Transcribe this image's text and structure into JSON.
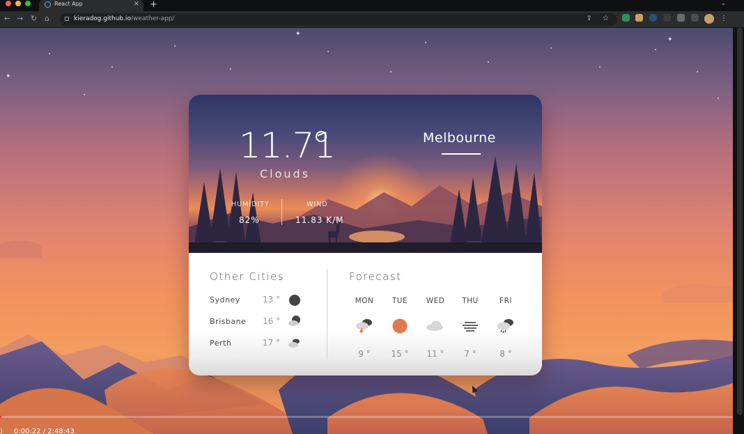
{
  "browser": {
    "tab_title": "React App",
    "tab_close": "×",
    "new_tab": "+",
    "tab_menu": "⌄",
    "url_host": "kieradog.github.io",
    "url_path": "/weather-app/",
    "back": "←",
    "forward": "→",
    "reload": "↻",
    "home": "⌂",
    "omnibox_icons": "⇪ ☆",
    "menu": "⋮"
  },
  "weather": {
    "temperature": "11.71",
    "condition": "Clouds",
    "city": "Melbourne",
    "humidity_label": "HUMIDITY",
    "humidity_value": "82%",
    "wind_label": "WIND",
    "wind_value": "11.83 K/M"
  },
  "other_cities": {
    "title": "Other Cities",
    "items": [
      {
        "name": "Sydney",
        "temp": "13 °",
        "icon": "clear-night-icon"
      },
      {
        "name": "Brisbane",
        "temp": "16 °",
        "icon": "partly-cloudy-night-icon"
      },
      {
        "name": "Perth",
        "temp": "17 °",
        "icon": "cloudy-icon"
      }
    ]
  },
  "forecast": {
    "title": "Forecast",
    "days": [
      {
        "day": "MON",
        "temp": "9 °",
        "icon": "thunderstorm-icon"
      },
      {
        "day": "TUE",
        "temp": "15 °",
        "icon": "sun-icon"
      },
      {
        "day": "WED",
        "temp": "11 °",
        "icon": "cloud-icon"
      },
      {
        "day": "THU",
        "temp": "7 °",
        "icon": "fog-icon"
      },
      {
        "day": "FRI",
        "temp": "8 °",
        "icon": "rain-icon"
      }
    ]
  },
  "video": {
    "timecode": "0:00:22 / 2:48:43",
    "volume": ")",
    "progress": 0.002
  },
  "colors": {
    "accent_sun": "#e07a4a",
    "progress": "#ff2b2b"
  }
}
